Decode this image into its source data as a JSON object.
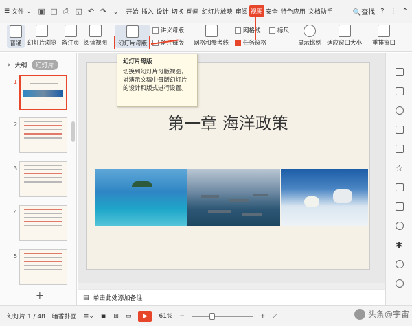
{
  "menubar": {
    "menu_label": "文件",
    "tabs": [
      "开始",
      "插入",
      "设计",
      "切换",
      "动画",
      "幻灯片放映",
      "审阅",
      "视图",
      "安全",
      "特色应用",
      "文档助手"
    ],
    "active_tab": "视图",
    "search_label": "查找"
  },
  "ribbon": {
    "normal": "普通",
    "sorter": "幻灯片浏览",
    "notes_page": "备注页",
    "reading": "阅读视图",
    "slide_master": "幻灯片母版",
    "handout_master": "讲义母版",
    "notes_master": "备注母版",
    "grid_guides": "网格和参考线",
    "gridlines": "网格线",
    "ruler": "标尺",
    "task_pane": "任务窗格",
    "zoom": "显示比例",
    "fit_window": "适应窗口大小",
    "arrange": "重排窗口"
  },
  "tooltip": {
    "title": "幻灯片母版",
    "body": "切换到幻灯片母版视图，对演示文稿中母版幻灯片的设计和版式进行设置。"
  },
  "leftpane": {
    "outline_tab": "大纲",
    "slides_tab": "幻灯片",
    "slide_numbers": [
      "1",
      "2",
      "3",
      "4",
      "5"
    ]
  },
  "slide": {
    "title": "第一章 海洋政策"
  },
  "notes": {
    "placeholder": "单击此处添加备注"
  },
  "statusbar": {
    "slide_count": "幻灯片 1 / 48",
    "theme": "暗香扑面",
    "zoom_percent": "61%"
  },
  "watermark": {
    "text": "头条@宇宙"
  },
  "colors": {
    "accent": "#e8462a"
  }
}
